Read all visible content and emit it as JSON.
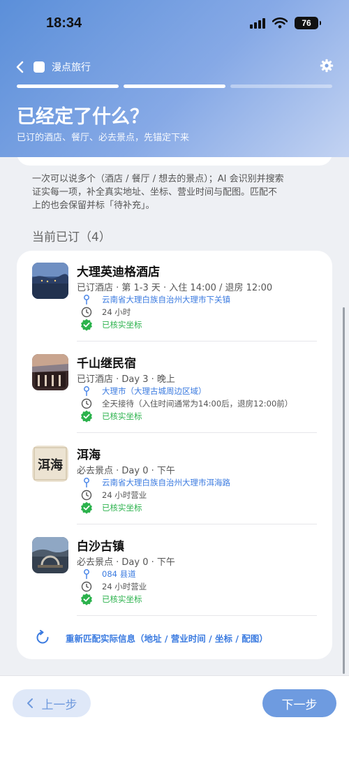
{
  "status_bar": {
    "time": "18:34",
    "battery": "76"
  },
  "nav": {
    "title": "漫点旅行"
  },
  "progress": {
    "total_steps": 3,
    "active_steps": 2
  },
  "page": {
    "title": "已经定了什么？",
    "subtitle": "已订的酒店、餐厅、必去景点，先锚定下来"
  },
  "hint_lines": [
    "一次可以说多个（酒店 / 餐厅 / 想去的景点）；AI 会识别并搜索",
    "证实每一项，补全真实地址、坐标、营业时间与配图。匹配不",
    "上的也会保留并标「待补充」。"
  ],
  "section_title": "当前已订（4）",
  "items": [
    {
      "name": "大理英迪格酒店",
      "meta": "已订酒店 · 第 1-3 天 · 入住 14:00 / 退房 12:00",
      "address": "云南省大理白族自治州大理市下关镇",
      "hours": "24 小时",
      "verified": "已核实坐标"
    },
    {
      "name": "千山继民宿",
      "meta": "已订酒店 · Day 3 · 晚上",
      "address": "大理市（大理古城周边区域）",
      "hours": "全天接待（入住时间通常为14:00后，退房12:00前）",
      "verified": "已核实坐标"
    },
    {
      "name": "洱海",
      "meta": "必去景点 · Day 0 · 下午",
      "address": "云南省大理白族自治州大理市洱海路",
      "hours": "24 小时营业",
      "verified": "已核实坐标",
      "thumb_text": "洱海"
    },
    {
      "name": "白沙古镇",
      "meta": "必去景点 · Day 0 · 下午",
      "address": "084 县道",
      "hours": "24 小时营业",
      "verified": "已核实坐标"
    }
  ],
  "rematch_label": "重新匹配实际信息（地址 / 营业时间 / 坐标 / 配图）",
  "buttons": {
    "prev": "上一步",
    "next": "下一步"
  },
  "colors": {
    "accent": "#3b7be0",
    "verified": "#2bb24c",
    "primary_button": "#6e9be0"
  }
}
